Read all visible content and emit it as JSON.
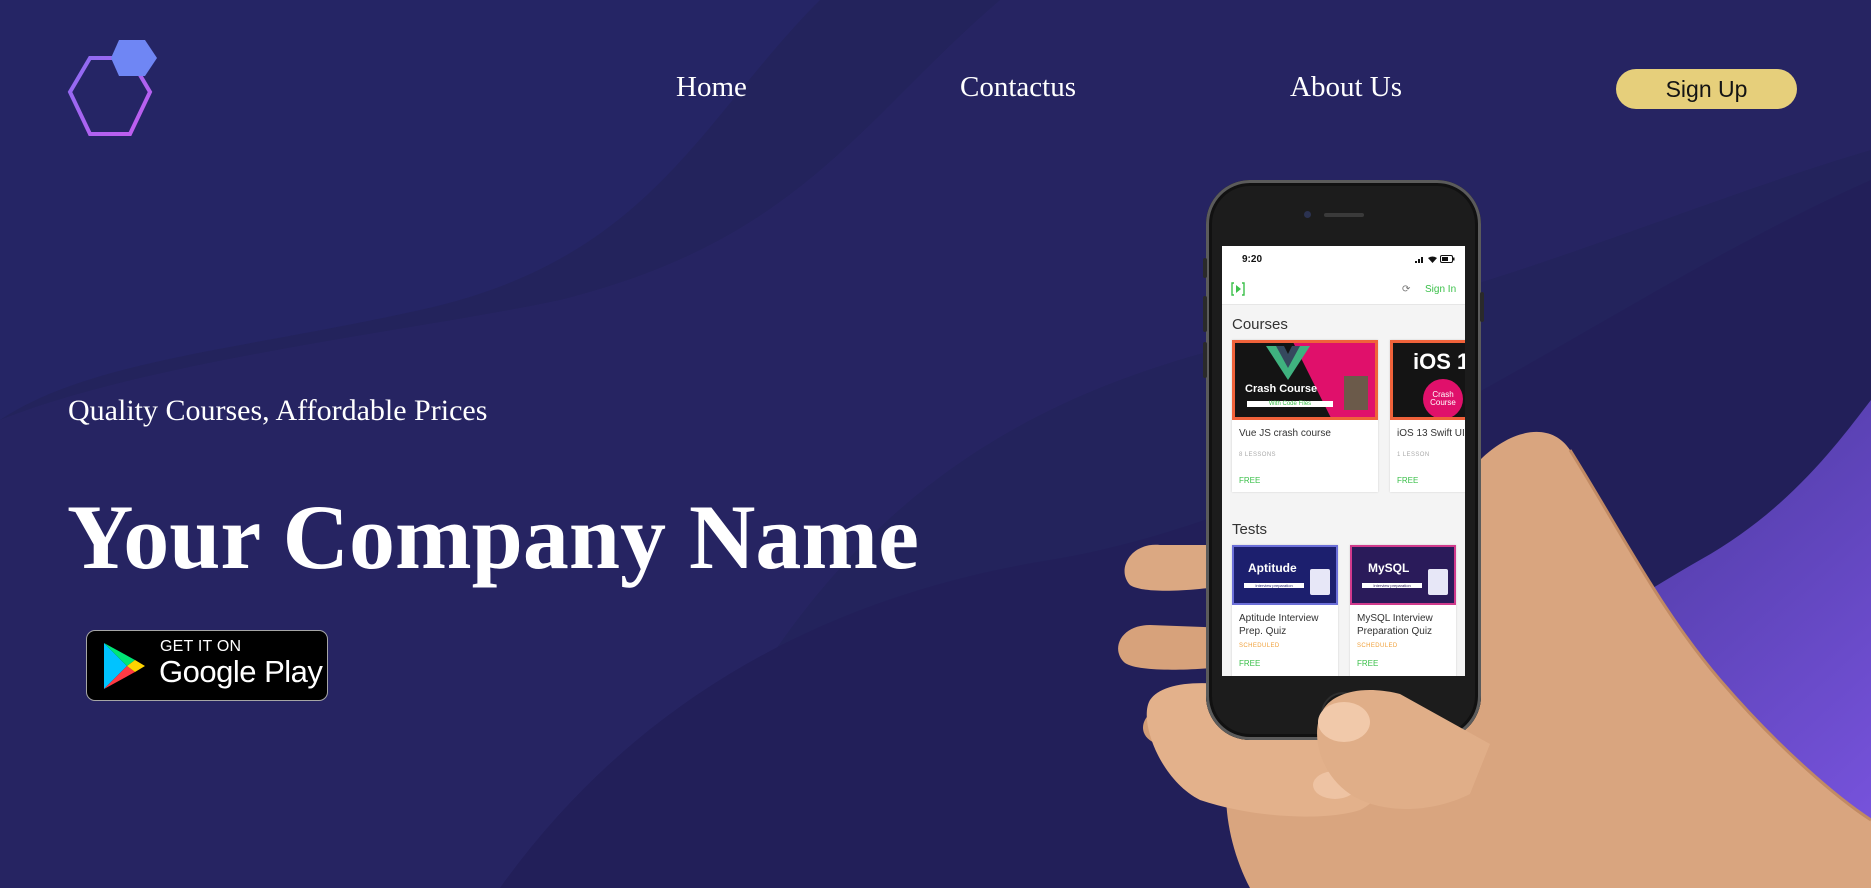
{
  "nav": {
    "links": [
      "Home",
      "Contactus",
      "About Us"
    ],
    "signup_label": "Sign Up"
  },
  "hero": {
    "tagline": "Quality Courses, Affordable Prices",
    "company_name": "Your Company Name"
  },
  "store_badge": {
    "small_text": "GET IT ON",
    "big_text": "Google Play"
  },
  "phone_app": {
    "status_time": "9:20",
    "signin_label": "Sign In",
    "sections": {
      "courses_title": "Courses",
      "tests_title": "Tests"
    },
    "courses": [
      {
        "thumb_title": "Crash Course",
        "thumb_sub": "With Code Files",
        "title": "Vue JS crash course",
        "meta": "8 LESSONS",
        "price": "FREE"
      },
      {
        "thumb_title": "iOS 1",
        "thumb_badge": "Crash Course",
        "title": "iOS 13 Swift UI",
        "meta": "1 LESSON",
        "price": "FREE"
      }
    ],
    "tests": [
      {
        "thumb_title": "Aptitude",
        "thumb_sub": "Interview preparation",
        "title_line1": "Aptitude Interview",
        "title_line2": "Prep. Quiz",
        "status": "SCHEDULED",
        "price": "FREE"
      },
      {
        "thumb_title": "MySQL",
        "thumb_sub": "Interview preparation",
        "title_line1": "MySQL Interview",
        "title_line2": "Preparation Quiz",
        "status": "SCHEDULED",
        "price": "FREE"
      }
    ]
  },
  "colors": {
    "background": "#23235c",
    "accent_purple": "#7a55e0",
    "signup_bg": "#e6cf7b",
    "logo_gradient_start": "#8a6cf2",
    "logo_gradient_end": "#c55cf0",
    "app_green": "#3bc04a"
  },
  "icons": {
    "logo": "hexagon-logo-icon",
    "play_store": "google-play-icon"
  }
}
